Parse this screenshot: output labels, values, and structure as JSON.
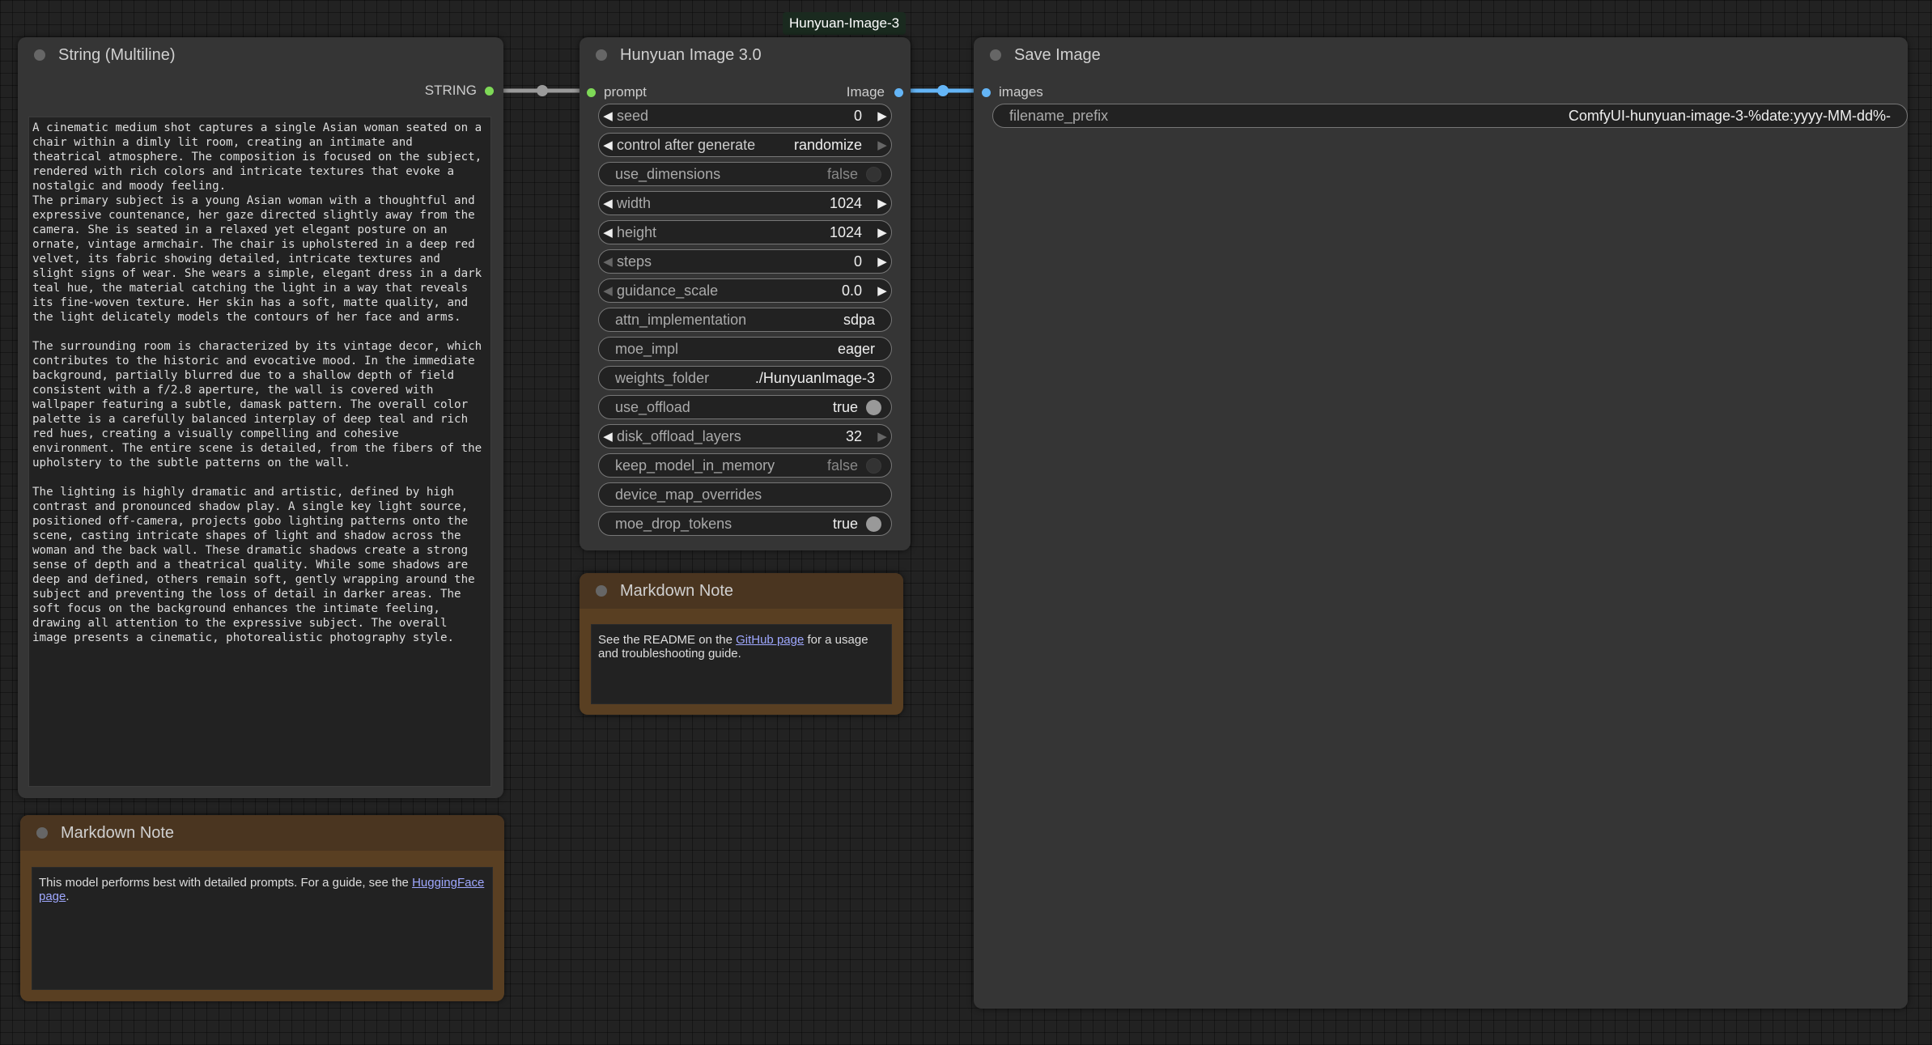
{
  "group": {
    "title": "Hunyuan-Image-3"
  },
  "string_node": {
    "title": "String (Multiline)",
    "output_label": "STRING",
    "text": "A cinematic medium shot captures a single Asian woman seated on a chair within a dimly lit room, creating an intimate and theatrical atmosphere. The composition is focused on the subject, rendered with rich colors and intricate textures that evoke a nostalgic and moody feeling.\nThe primary subject is a young Asian woman with a thoughtful and expressive countenance, her gaze directed slightly away from the camera. She is seated in a relaxed yet elegant posture on an ornate, vintage armchair. The chair is upholstered in a deep red velvet, its fabric showing detailed, intricate textures and slight signs of wear. She wears a simple, elegant dress in a dark teal hue, the material catching the light in a way that reveals its fine-woven texture. Her skin has a soft, matte quality, and the light delicately models the contours of her face and arms.\n\nThe surrounding room is characterized by its vintage decor, which contributes to the historic and evocative mood. In the immediate background, partially blurred due to a shallow depth of field consistent with a f/2.8 aperture, the wall is covered with wallpaper featuring a subtle, damask pattern. The overall color palette is a carefully balanced interplay of deep teal and rich red hues, creating a visually compelling and cohesive environment. The entire scene is detailed, from the fibers of the upholstery to the subtle patterns on the wall.\n\nThe lighting is highly dramatic and artistic, defined by high contrast and pronounced shadow play. A single key light source, positioned off-camera, projects gobo lighting patterns onto the scene, casting intricate shapes of light and shadow across the woman and the back wall. These dramatic shadows create a strong sense of depth and a theatrical quality. While some shadows are deep and defined, others remain soft, gently wrapping around the subject and preventing the loss of detail in darker areas. The soft focus on the background enhances the intimate feeling, drawing all attention to the expressive subject. The overall image presents a cinematic, photorealistic photography style."
  },
  "hunyuan_node": {
    "title": "Hunyuan Image 3.0",
    "input_label": "prompt",
    "output_label": "Image",
    "widgets": {
      "seed": {
        "label": "seed",
        "value": "0"
      },
      "control": {
        "label": "control after generate",
        "value": "randomize"
      },
      "use_dimensions": {
        "label": "use_dimensions",
        "value": "false"
      },
      "width": {
        "label": "width",
        "value": "1024"
      },
      "height": {
        "label": "height",
        "value": "1024"
      },
      "steps": {
        "label": "steps",
        "value": "0"
      },
      "guidance_scale": {
        "label": "guidance_scale",
        "value": "0.0"
      },
      "attn_implementation": {
        "label": "attn_implementation",
        "value": "sdpa"
      },
      "moe_impl": {
        "label": "moe_impl",
        "value": "eager"
      },
      "weights_folder": {
        "label": "weights_folder",
        "value": "./HunyuanImage-3"
      },
      "use_offload": {
        "label": "use_offload",
        "value": "true"
      },
      "disk_offload_layers": {
        "label": "disk_offload_layers",
        "value": "32"
      },
      "keep_model_in_memory": {
        "label": "keep_model_in_memory",
        "value": "false"
      },
      "device_map_overrides": {
        "label": "device_map_overrides",
        "value": ""
      },
      "moe_drop_tokens": {
        "label": "moe_drop_tokens",
        "value": "true"
      }
    }
  },
  "save_node": {
    "title": "Save Image",
    "input_label": "images",
    "filename_prefix": {
      "label": "filename_prefix",
      "value": "ComfyUI-hunyuan-image-3-%date:yyyy-MM-dd%-"
    }
  },
  "note_left": {
    "title": "Markdown Note",
    "text_before": "This model performs best with detailed prompts. For a guide, see the ",
    "link": "HuggingFace page",
    "text_after": "."
  },
  "note_middle": {
    "title": "Markdown Note",
    "text_before": "See the README on the ",
    "link": "GitHub page",
    "text_after": " for a usage and troubleshooting guide."
  },
  "colors": {
    "string_link": "#9a9a9a",
    "image_link": "#64b5f6",
    "string_slot": "#7ed957",
    "image_slot": "#64b5f6"
  }
}
